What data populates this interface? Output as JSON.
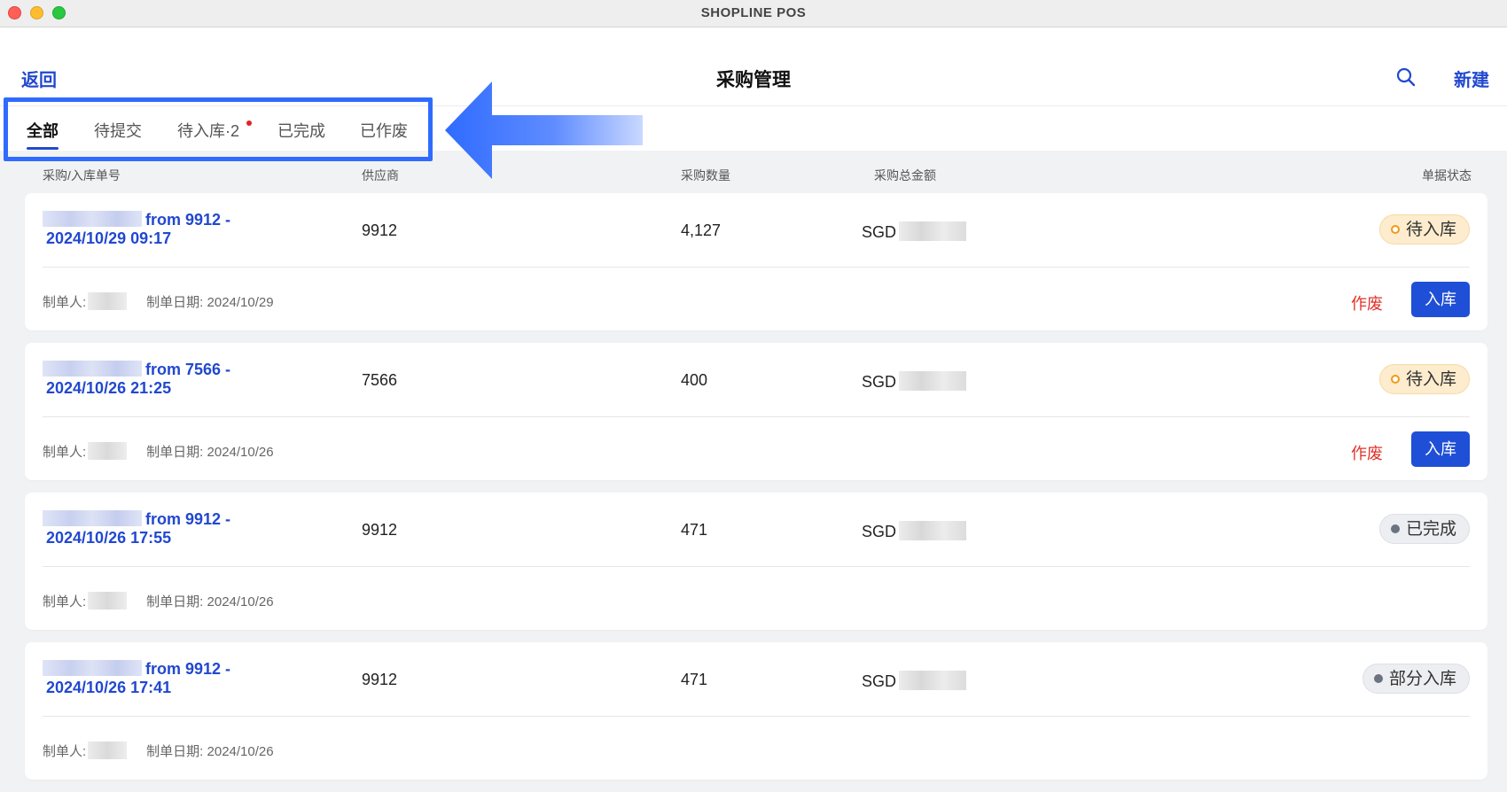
{
  "window": {
    "title": "SHOPLINE POS"
  },
  "header": {
    "back_label": "返回",
    "title": "采购管理",
    "new_label": "新建"
  },
  "tabs": [
    {
      "label": "全部",
      "active": true
    },
    {
      "label": "待提交",
      "active": false
    },
    {
      "label": "待入库·2",
      "active": false,
      "has_dot": true
    },
    {
      "label": "已完成",
      "active": false
    },
    {
      "label": "已作废",
      "active": false
    }
  ],
  "columns": {
    "order_no": "采购/入库单号",
    "supplier": "供应商",
    "quantity": "采购数量",
    "total": "采购总金额",
    "status": "单据状态"
  },
  "labels": {
    "creator": "制单人:",
    "created_date": "制单日期:"
  },
  "orders": [
    {
      "order_line1": "from 9912 -",
      "order_line2": "2024/10/29 09:17",
      "supplier": "9912",
      "quantity": "4,127",
      "currency": "SGD",
      "created_date": "2024/10/29",
      "status": "待入库",
      "actions": {
        "void": "作废",
        "stock_in": "入库"
      }
    },
    {
      "order_line1": "from 7566 -",
      "order_line2": "2024/10/26 21:25",
      "supplier": "7566",
      "quantity": "400",
      "currency": "SGD",
      "created_date": "2024/10/26",
      "status": "待入库",
      "actions": {
        "void": "作废",
        "stock_in": "入库"
      }
    },
    {
      "order_line1": "from 9912 -",
      "order_line2": "2024/10/26 17:55",
      "supplier": "9912",
      "quantity": "471",
      "currency": "SGD",
      "created_date": "2024/10/26",
      "status": "已完成"
    },
    {
      "order_line1": "from 9912 -",
      "order_line2": "2024/10/26 17:41",
      "supplier": "9912",
      "quantity": "471",
      "currency": "SGD",
      "created_date": "2024/10/26",
      "status": "部分入库"
    }
  ],
  "colors": {
    "accent": "#2148cf",
    "primary_button": "#1f4fd6",
    "danger": "#e0322b",
    "pending_badge": "#fdeccd",
    "highlight": "#2f6bff"
  },
  "icons": {
    "search": "search-icon",
    "arrow": "arrow-left-icon"
  }
}
